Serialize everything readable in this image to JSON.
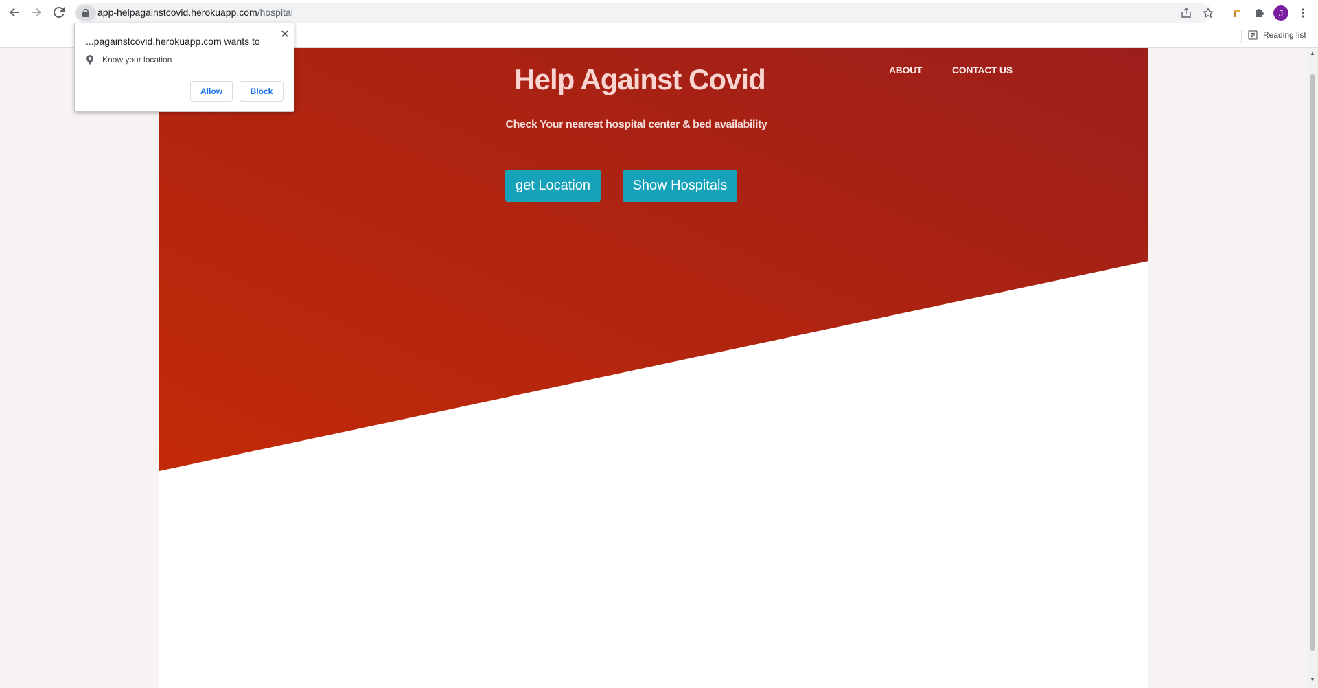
{
  "browser": {
    "url_host": "app-helpagainstcovid.herokuapp.com",
    "url_path": "/hospital",
    "reading_list_label": "Reading list",
    "avatar_initial": "J"
  },
  "permission_prompt": {
    "title": "...pagainstcovid.herokuapp.com wants to",
    "permission": "Know your location",
    "allow_label": "Allow",
    "block_label": "Block"
  },
  "site": {
    "title": "Help Against Covid",
    "nav": [
      "ABOUT",
      "CONTACT US"
    ],
    "tagline": "Check Your nearest hospital center & bed availability",
    "buttons": {
      "get_location": "get Location",
      "show_hospitals": "Show Hospitals"
    }
  },
  "colors": {
    "hero_start": "#c32a07",
    "hero_end": "#9c1e1a",
    "button": "#16a2b8",
    "avatar": "#7b1fa2"
  }
}
